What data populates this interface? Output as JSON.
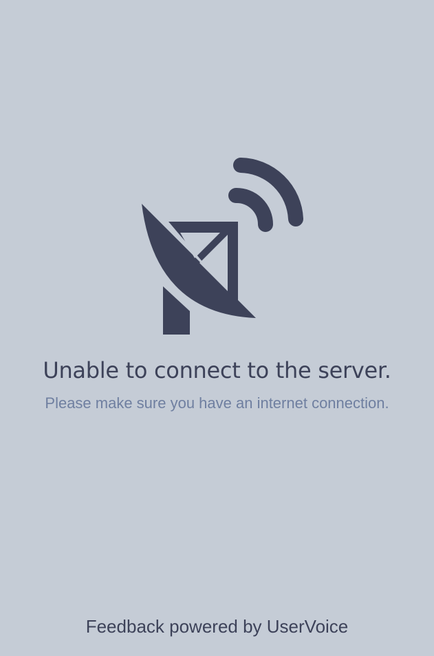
{
  "error": {
    "icon": "satellite-dish-signal-icon",
    "title": "Unable to connect to the server.",
    "message": "Please make sure you have an internet connection."
  },
  "footer": {
    "text": "Feedback powered by UserVoice"
  },
  "colors": {
    "background": "#c5ccd6",
    "icon": "#3d4259",
    "title": "#3d4259",
    "message": "#6f7fa0"
  }
}
